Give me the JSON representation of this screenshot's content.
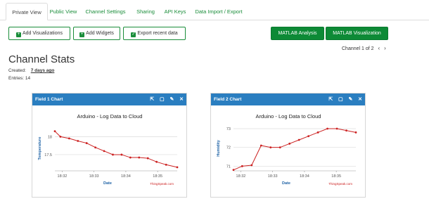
{
  "tabs": [
    "Private View",
    "Public View",
    "Channel Settings",
    "Sharing",
    "API Keys",
    "Data Import / Export"
  ],
  "toolbar": {
    "add_visualizations": "Add Visualizations",
    "add_widgets": "Add Widgets",
    "export_recent": "Export recent data",
    "matlab_analysis": "MATLAB Analysis",
    "matlab_visualization": "MATLAB Visualization"
  },
  "channel_nav": {
    "label": "Channel 1 of 2"
  },
  "page": {
    "title": "Channel Stats",
    "created_label": "Created:",
    "created_value": "7 days ago",
    "entries_label": "Entries:",
    "entries_value": "14"
  },
  "cards": [
    {
      "header": "Field 1 Chart"
    },
    {
      "header": "Field 2 Chart"
    }
  ],
  "colors": {
    "accent": "#0d8a36",
    "card_header": "#2a7ec0",
    "series": "#cc2222"
  },
  "chart_data": [
    {
      "type": "line",
      "title": "Arduino - Log Data to Cloud",
      "xlabel": "Date",
      "ylabel": "Temperature",
      "x_ticks": [
        "18:32",
        "18:33",
        "18:34",
        "18:35"
      ],
      "y_ticks": [
        "17.5",
        "18"
      ],
      "ylim": [
        17.05,
        18.3
      ],
      "x": [
        0.0,
        0.14,
        0.36,
        0.58,
        0.8,
        1.02,
        1.24,
        1.46,
        1.68,
        1.9,
        2.12,
        2.34,
        2.56,
        2.8,
        3.08
      ],
      "values": [
        18.15,
        18.0,
        17.95,
        17.88,
        17.82,
        17.7,
        17.6,
        17.5,
        17.5,
        17.42,
        17.42,
        17.4,
        17.3,
        17.22,
        17.15
      ],
      "credit": "ThingSpeak.com",
      "grid": true
    },
    {
      "type": "line",
      "title": "Arduino - Log Data to Cloud",
      "xlabel": "Date",
      "ylabel": "Humidity",
      "x_ticks": [
        "18:32",
        "18:33",
        "18:34",
        "18:35"
      ],
      "y_ticks": [
        "71",
        "72",
        "73"
      ],
      "ylim": [
        70.75,
        73.15
      ],
      "x": [
        0.0,
        0.22,
        0.46,
        0.7,
        0.94,
        1.18,
        1.42,
        1.66,
        1.9,
        2.14,
        2.38,
        2.62,
        2.86,
        3.1
      ],
      "values": [
        70.8,
        71.0,
        71.05,
        72.1,
        72.0,
        72.0,
        72.2,
        72.4,
        72.6,
        72.8,
        73.0,
        73.0,
        72.9,
        72.8
      ],
      "credit": "ThingSpeak.com",
      "grid": true
    }
  ]
}
